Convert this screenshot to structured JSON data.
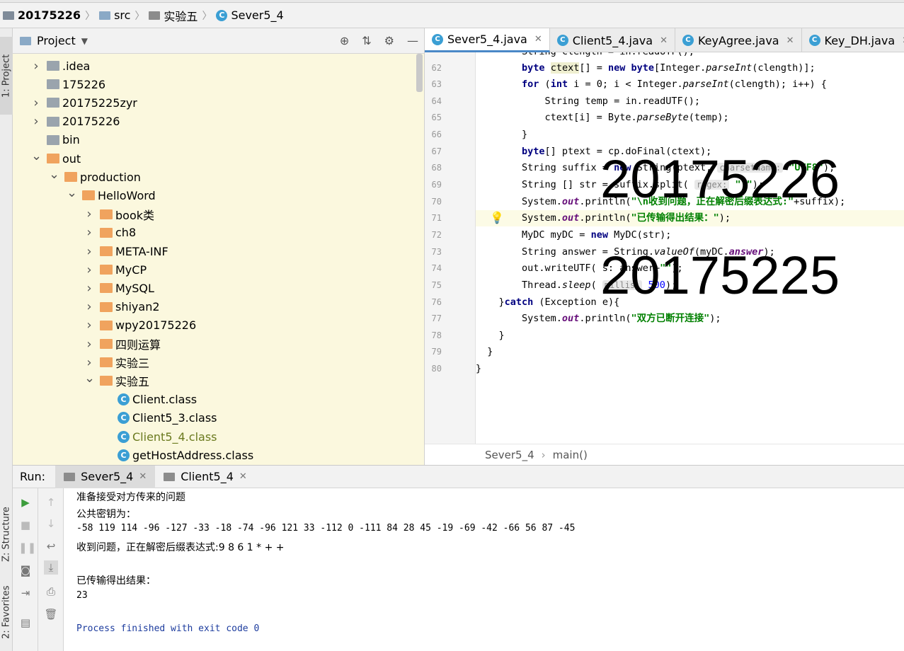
{
  "breadcrumb": [
    {
      "label": "20175226",
      "icon": "module-icon"
    },
    {
      "label": "src",
      "icon": "folder-icon"
    },
    {
      "label": "实验五",
      "icon": "package-icon"
    },
    {
      "label": "Sever5_4",
      "icon": "class-icon"
    }
  ],
  "left_stripe": {
    "project_tab": "1: Project",
    "structure_tab": "Z: Structure",
    "favorites_tab": "2: Favorites"
  },
  "project_panel": {
    "title": "Project",
    "tree": [
      {
        "label": ".idea",
        "depth": 0,
        "arrow": "right",
        "type": "gray"
      },
      {
        "label": "175226",
        "depth": 0,
        "arrow": "",
        "type": "gray"
      },
      {
        "label": "20175225zyr",
        "depth": 0,
        "arrow": "right",
        "type": "gray"
      },
      {
        "label": "20175226",
        "depth": 0,
        "arrow": "right",
        "type": "gray"
      },
      {
        "label": "bin",
        "depth": 0,
        "arrow": "",
        "type": "gray"
      },
      {
        "label": "out",
        "depth": 0,
        "arrow": "down",
        "type": "orange"
      },
      {
        "label": "production",
        "depth": 1,
        "arrow": "down",
        "type": "orange"
      },
      {
        "label": "HelloWord",
        "depth": 2,
        "arrow": "down",
        "type": "orange"
      },
      {
        "label": "book类",
        "depth": 3,
        "arrow": "right",
        "type": "orange"
      },
      {
        "label": "ch8",
        "depth": 3,
        "arrow": "right",
        "type": "orange"
      },
      {
        "label": "META-INF",
        "depth": 3,
        "arrow": "right",
        "type": "orange"
      },
      {
        "label": "MyCP",
        "depth": 3,
        "arrow": "right",
        "type": "orange"
      },
      {
        "label": "MySQL",
        "depth": 3,
        "arrow": "right",
        "type": "orange"
      },
      {
        "label": "shiyan2",
        "depth": 3,
        "arrow": "right",
        "type": "orange"
      },
      {
        "label": "wpy20175226",
        "depth": 3,
        "arrow": "right",
        "type": "orange"
      },
      {
        "label": "四则运算",
        "depth": 3,
        "arrow": "right",
        "type": "orange"
      },
      {
        "label": "实验三",
        "depth": 3,
        "arrow": "right",
        "type": "orange"
      },
      {
        "label": "实验五",
        "depth": 3,
        "arrow": "down",
        "type": "orange"
      },
      {
        "label": "Client.class",
        "depth": 4,
        "arrow": "",
        "type": "class"
      },
      {
        "label": "Client5_3.class",
        "depth": 4,
        "arrow": "",
        "type": "class"
      },
      {
        "label": "Client5_4.class",
        "depth": 4,
        "arrow": "",
        "type": "class",
        "dim": true
      },
      {
        "label": "getHostAddress.class",
        "depth": 4,
        "arrow": "",
        "type": "class"
      }
    ]
  },
  "editor": {
    "tabs": [
      {
        "label": "Sever5_4.java",
        "active": true
      },
      {
        "label": "Client5_4.java",
        "active": false
      },
      {
        "label": "KeyAgree.java",
        "active": false
      },
      {
        "label": "Key_DH.java",
        "active": false
      }
    ],
    "line_numbers": [
      "62",
      "63",
      "64",
      "65",
      "66",
      "67",
      "68",
      "69",
      "70",
      "71",
      "72",
      "73",
      "74",
      "75",
      "76",
      "77",
      "78",
      "79",
      "80"
    ],
    "bottom_crumb_class": "Sever5_4",
    "bottom_crumb_method": "main()",
    "overlay_1": "20175226",
    "overlay_2": "20175225",
    "hint_charset": "charsetName:",
    "hint_regex": "regex:",
    "hint_millis": "millis:"
  },
  "run_panel": {
    "label": "Run:",
    "tabs": [
      {
        "label": "Sever5_4",
        "active": true
      },
      {
        "label": "Client5_4",
        "active": false
      }
    ],
    "output": [
      "准备接受对方传来的问题",
      "公共密钥为：",
      "-58 119 114 -96 -127 -33 -18 -74 -96 121 33 -112 0 -111 84 28 45 -19 -69 -42 -66 56 87 -45",
      "收到问题，正在解密后缀表达式:9 8 6 1 * + +",
      "",
      "已传输得出结果：",
      "23",
      "",
      "Process finished with exit code 0"
    ]
  }
}
